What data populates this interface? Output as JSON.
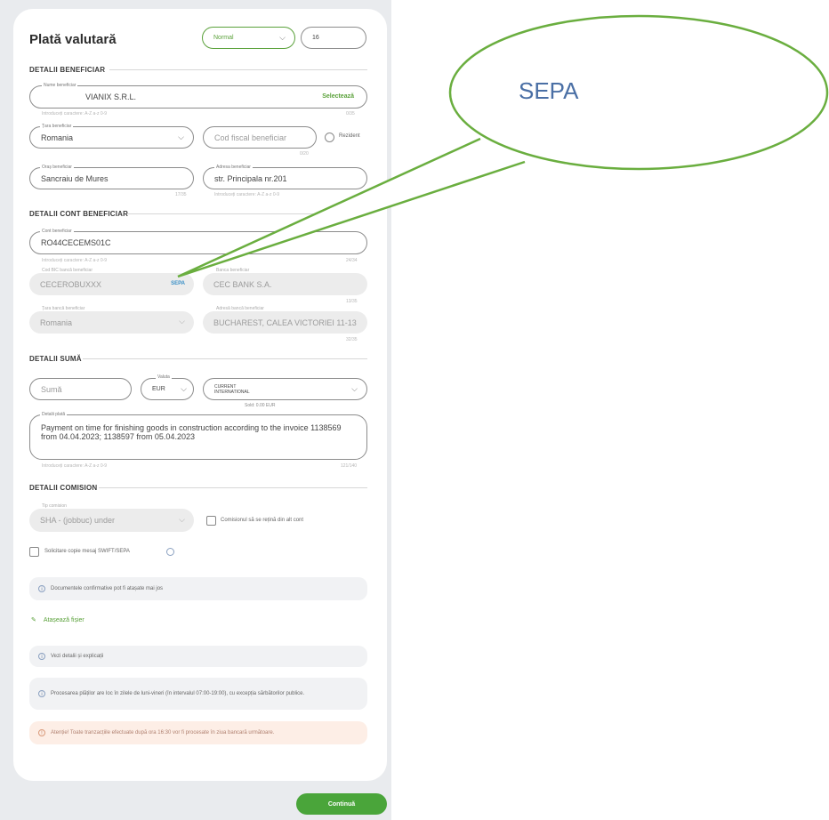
{
  "page": {
    "title": "Plată valutară",
    "urgency_select": "Normal",
    "small_field_value": "16",
    "continue_label": "Continuă"
  },
  "beneficiary": {
    "section": "DETALII BENEFICIAR",
    "name_label": "Nume beneficiar",
    "name_value": "VIANIX S.R.L.",
    "name_action": "Selectează",
    "name_helper": "Introduceți caractere: A-Z a-z 0-9",
    "name_count": "0/35",
    "country_label": "Țara beneficiar",
    "country_value": "Romania",
    "fiscal_placeholder": "Cod fiscal beneficiar",
    "fiscal_count": "0/20",
    "resident_label": "Rezident",
    "city_label": "Oraș beneficiar",
    "city_value": "Sancraiu de Mures",
    "city_count": "17/35",
    "address_label": "Adresa beneficiar",
    "address_value": "str. Principala nr.201",
    "address_helper": "Introduceți caractere: A-Z a-z 0-9"
  },
  "account": {
    "section": "DETALII CONT BENEFICIAR",
    "iban_label": "Cont beneficiar",
    "iban_value": "RO44CECEMS01C",
    "iban_helper": "Introduceți caractere: A-Z a-z 0-9",
    "iban_count": "24/34",
    "bic_label": "Cod BIC bancă beneficiar",
    "bic_value": "CECEROBUXXX",
    "bic_tag": "SEPA",
    "bank_label": "Banca beneficiar",
    "bank_value": "CEC BANK S.A.",
    "bank_count": "13/35",
    "bank_country_label": "Țara bancă beneficiar",
    "bank_country_value": "Romania",
    "bank_address_label": "Adresă bancă beneficiar",
    "bank_address_value": "BUCHAREST, CALEA VICTORIEI 11-13",
    "bank_address_count": "32/35"
  },
  "amount": {
    "section": "DETALII SUMĂ",
    "sum_placeholder": "Sumă",
    "currency_label": "Valuta",
    "currency_value": "EUR",
    "account_line1": "CURRENT",
    "account_line2": "INTERNATIONAL",
    "account_helper": "Sold: 0.00 EUR",
    "details_label": "Detalii plată",
    "details_value": "Payment on time for finishing goods in construction according to the invoice 1138569 from 04.04.2023; 1138597 from 05.04.2023",
    "details_helper": "Introduceți caractere: A-Z a-z 0-9",
    "details_count": "121/140"
  },
  "commission": {
    "section": "DETALII COMISION",
    "type_label": "Tip comision",
    "type_value": "SHA - (jobbuc) under",
    "other_account_label": "Comisionul să se rețină din alt cont",
    "swift_copy_label": "Solicitare copie mesaj SWIFT/SEPA"
  },
  "notices": {
    "documents": "Documentele confirmative pot fi atașate mai jos",
    "attach_label": "Atașează fișier",
    "details": "Vezi detalii și explicații",
    "processing": "Procesarea plăților are loc în zilele de luni-vineri (în intervalul 07:00-19:00), cu excepția sărbătorilor publice.",
    "warning": "Atenție! Toate tranzacțiile efectuate după ora 16:30 vor fi procesate în ziua bancară următoare."
  },
  "annotation": {
    "callout_text": "SEPA"
  },
  "colors": {
    "accent": "#4aa53a",
    "link": "#3a8fc7",
    "callout_stroke": "#6aae3f",
    "callout_text": "#4a6fa5"
  }
}
